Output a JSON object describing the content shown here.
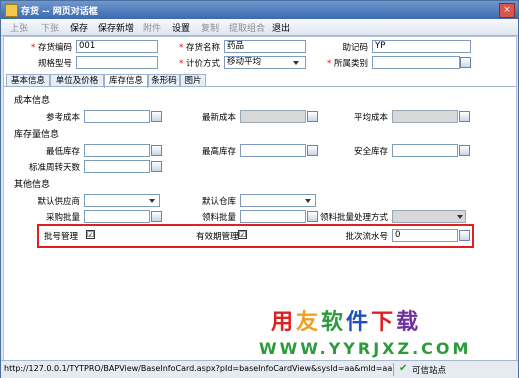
{
  "window": {
    "title": "存货 -- 网页对话框",
    "close": "×"
  },
  "toolbar": {
    "buttons": [
      {
        "label": "上张",
        "enabled": false
      },
      {
        "label": "下张",
        "enabled": false
      },
      {
        "label": "保存",
        "enabled": true
      },
      {
        "label": "保存新增",
        "enabled": true
      },
      {
        "label": "附件",
        "enabled": false
      },
      {
        "label": "设置",
        "enabled": true
      },
      {
        "label": "复制",
        "enabled": false
      },
      {
        "label": "提取组合",
        "enabled": false
      },
      {
        "label": "退出",
        "enabled": true
      }
    ]
  },
  "header": {
    "code_label": "存货编码",
    "code_value": "001",
    "name_label": "存货名称",
    "name_value": "药品",
    "mnemonic_label": "助记码",
    "mnemonic_value": "YP",
    "spec_label": "规格型号",
    "spec_value": "",
    "pricing_label": "计价方式",
    "pricing_value": "移动平均",
    "category_label": "所属类别",
    "category_value": ""
  },
  "tabs": [
    {
      "label": "基本信息",
      "active": false
    },
    {
      "label": "单位及价格",
      "active": false
    },
    {
      "label": "库存信息",
      "active": true
    },
    {
      "label": "条形码",
      "active": false
    },
    {
      "label": "图片",
      "active": false
    }
  ],
  "cost": {
    "section": "成本信息",
    "ref_cost_label": "参考成本",
    "latest_cost_label": "最新成本",
    "avg_cost_label": "平均成本"
  },
  "stock": {
    "section": "库存量信息",
    "min_label": "最低库存",
    "max_label": "最高库存",
    "safe_label": "安全库存",
    "turnover_label": "标准周转天数"
  },
  "other": {
    "section": "其他信息",
    "supplier_label": "默认供应商",
    "warehouse_label": "默认仓库",
    "purchase_batch_label": "采购批量",
    "pick_batch_label": "领料批量",
    "pick_method_label": "领料批量处理方式"
  },
  "highlight": {
    "batch_mgmt_label": "批号管理",
    "batch_mgmt_checked": true,
    "expiry_mgmt_label": "有效期管理",
    "expiry_mgmt_checked": true,
    "serial_label": "批次流水号",
    "serial_value": "0",
    "check_mark": "☑"
  },
  "status": {
    "url": "http://127.0.0.1/TYTPRO/BAPView/BaseInfoCard.aspx?pId=baseInfoCardView&sysId=aa&mId=aa1022@NodeV",
    "zone": "可信站点",
    "tick": "✔"
  },
  "watermark": {
    "line1": "用友软件下载",
    "line2": "WWW.YYRJXZ.COM",
    "line1_colors": [
      "#e02020",
      "#f0a020",
      "#2a9d3a",
      "#2050c0",
      "#e02020",
      "#7030a0"
    ]
  },
  "colors": {
    "title_bar": "#3b6aae",
    "highlight_border": "#e02020",
    "required_star": "#e00000"
  }
}
